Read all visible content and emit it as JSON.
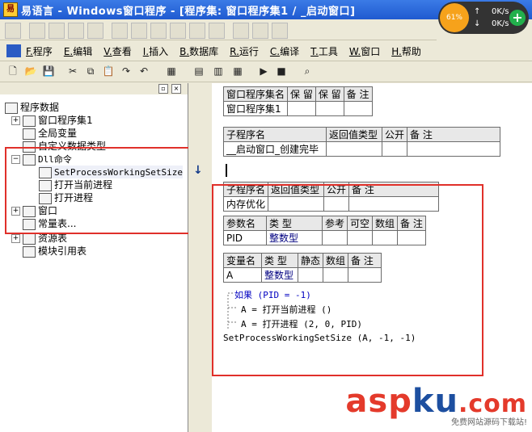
{
  "window": {
    "title": "易语言 - Windows窗口程序 - [程序集: 窗口程序集1 / _启动窗口]"
  },
  "net_monitor": {
    "cpu": "61%",
    "up": "0K/s",
    "down": "0K/s"
  },
  "menu": [
    {
      "key": "F.",
      "label": "程序"
    },
    {
      "key": "E.",
      "label": "编辑"
    },
    {
      "key": "V.",
      "label": "查看"
    },
    {
      "key": "I.",
      "label": "插入"
    },
    {
      "key": "B.",
      "label": "数据库"
    },
    {
      "key": "R.",
      "label": "运行"
    },
    {
      "key": "C.",
      "label": "编译"
    },
    {
      "key": "T.",
      "label": "工具"
    },
    {
      "key": "W.",
      "label": "窗口"
    },
    {
      "key": "H.",
      "label": "帮助"
    }
  ],
  "tree": {
    "root": "程序数据",
    "items": [
      "窗口程序集1",
      "全局变量",
      "自定义数据类型",
      "Dll命令",
      "SetProcessWorkingSetSize",
      "打开当前进程",
      "打开进程",
      "窗口",
      "常量表...",
      "资源表",
      "模块引用表"
    ]
  },
  "assembly_table": {
    "headers": [
      "窗口程序集名",
      "保 留",
      "保 留",
      "备 注"
    ],
    "row": [
      "窗口程序集1",
      "",
      "",
      ""
    ]
  },
  "sub1": {
    "headers": [
      "子程序名",
      "返回值类型",
      "公开",
      "备 注"
    ],
    "row": [
      "__启动窗口_创建完毕",
      "",
      "",
      ""
    ]
  },
  "sub2": {
    "headers": [
      "子程序名",
      "返回值类型",
      "公开",
      "备 注"
    ],
    "row": [
      "内存优化",
      "",
      "",
      ""
    ],
    "param_headers": [
      "参数名",
      "类 型",
      "参考",
      "可空",
      "数组",
      "备 注"
    ],
    "param_row": [
      "PID",
      "整数型",
      "",
      "",
      "",
      ""
    ],
    "var_headers": [
      "变量名",
      "类 型",
      "静态",
      "数组",
      "备 注"
    ],
    "var_row": [
      "A",
      "整数型",
      "",
      "",
      ""
    ]
  },
  "code": {
    "line1": "如果 (PID = -1)",
    "line2": "A = 打开当前进程 ()",
    "line3": "A = 打开进程 (2, 0, PID)",
    "line4": "SetProcessWorkingSetSize (A, -1, -1)"
  },
  "watermark": {
    "brand_a": "asp",
    "brand_b": "ku",
    "brand_c": ".com",
    "sub": "免费网站源码下载站!"
  },
  "colors": {
    "highlight_box": "#e0302a",
    "titlebar": "#1f5ad0"
  }
}
